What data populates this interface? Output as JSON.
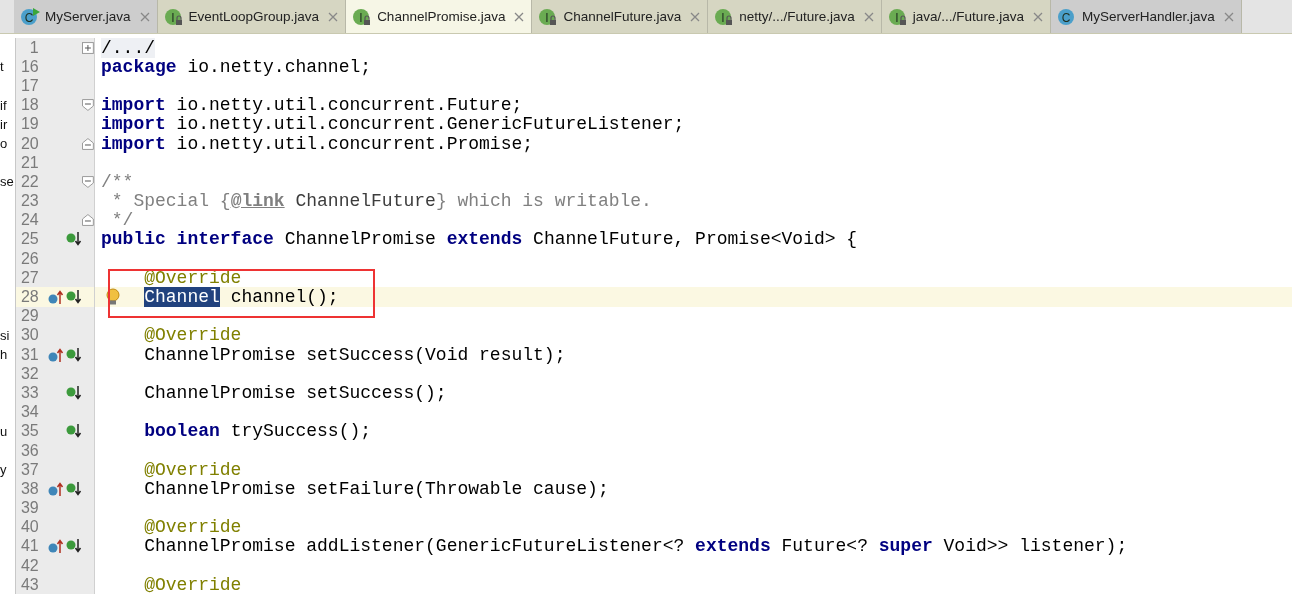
{
  "tabs": [
    {
      "label": "MyServer.java",
      "kind": "class-run",
      "icon_letter": "C",
      "selected": false
    },
    {
      "label": "EventLoopGroup.java",
      "kind": "interface",
      "icon_letter": "I",
      "selected": false
    },
    {
      "label": "ChannelPromise.java",
      "kind": "interface",
      "icon_letter": "I",
      "selected": true
    },
    {
      "label": "ChannelFuture.java",
      "kind": "interface",
      "icon_letter": "I",
      "selected": false
    },
    {
      "label": "netty/.../Future.java",
      "kind": "interface",
      "icon_letter": "I",
      "selected": false
    },
    {
      "label": "java/.../Future.java",
      "kind": "interface",
      "icon_letter": "I",
      "selected": false
    },
    {
      "label": "MyServerHandler.java",
      "kind": "class",
      "icon_letter": "C",
      "selected": false
    }
  ],
  "lines": [
    {
      "number": "1",
      "fold": {
        "kind": "collapsed"
      },
      "tokens": [
        {
          "kind": "folded",
          "text": "/.../"
        }
      ]
    },
    {
      "number": "16",
      "side": "t",
      "tokens": [
        {
          "kind": "keyword",
          "text": "package"
        },
        {
          "kind": "plain",
          "text": " io.netty.channel;"
        }
      ]
    },
    {
      "number": "17"
    },
    {
      "number": "18",
      "side": "if",
      "fold": {
        "kind": "start"
      },
      "tokens": [
        {
          "kind": "keyword",
          "text": "import"
        },
        {
          "kind": "plain",
          "text": " io.netty.util.concurrent.Future;"
        }
      ]
    },
    {
      "number": "19",
      "side": "ir",
      "tokens": [
        {
          "kind": "keyword",
          "text": "import"
        },
        {
          "kind": "plain",
          "text": " io.netty.util.concurrent.GenericFutureListener;"
        }
      ]
    },
    {
      "number": "20",
      "side": "o",
      "fold": {
        "kind": "end"
      },
      "tokens": [
        {
          "kind": "keyword",
          "text": "import"
        },
        {
          "kind": "plain",
          "text": " io.netty.util.concurrent.Promise;"
        }
      ]
    },
    {
      "number": "21"
    },
    {
      "number": "22",
      "side": "se",
      "fold": {
        "kind": "start"
      },
      "tokens": [
        {
          "kind": "comment",
          "text": "/**"
        }
      ]
    },
    {
      "number": "23",
      "tokens": [
        {
          "kind": "comment",
          "text": " * Special {"
        },
        {
          "kind": "doctag",
          "text": "@link"
        },
        {
          "kind": "docref",
          "text": " ChannelFuture"
        },
        {
          "kind": "comment",
          "text": "} which is writable."
        }
      ]
    },
    {
      "number": "24",
      "fold": {
        "kind": "end"
      },
      "tokens": [
        {
          "kind": "comment",
          "text": " */"
        }
      ]
    },
    {
      "number": "25",
      "markers": [
        {
          "kind": "implemented"
        }
      ],
      "tokens": [
        {
          "kind": "keyword",
          "text": "public interface"
        },
        {
          "kind": "plain",
          "text": " ChannelPromise "
        },
        {
          "kind": "keyword",
          "text": "extends"
        },
        {
          "kind": "plain",
          "text": " ChannelFuture, Promise<Void> {"
        }
      ],
      "children": [
        {
          "number": "26"
        },
        {
          "number": "27",
          "boxed": true,
          "tokens": [
            {
              "kind": "annotation",
              "text": "@Override"
            }
          ]
        },
        {
          "number": "28",
          "boxed": true,
          "current": true,
          "bulb": true,
          "markers": [
            {
              "kind": "overrides"
            },
            {
              "kind": "implemented"
            }
          ],
          "tokens": [
            {
              "kind": "plain",
              "text": "Channel",
              "selected": true
            },
            {
              "kind": "plain",
              "text": " channel();"
            }
          ]
        },
        {
          "number": "29"
        },
        {
          "number": "30",
          "side": "si",
          "tokens": [
            {
              "kind": "annotation",
              "text": "@Override"
            }
          ]
        },
        {
          "number": "31",
          "side": "h",
          "markers": [
            {
              "kind": "overrides"
            },
            {
              "kind": "implemented"
            }
          ],
          "tokens": [
            {
              "kind": "plain",
              "text": "ChannelPromise setSuccess(Void result);"
            }
          ]
        },
        {
          "number": "32"
        },
        {
          "number": "33",
          "markers": [
            {
              "kind": "implemented"
            }
          ],
          "tokens": [
            {
              "kind": "plain",
              "text": "ChannelPromise setSuccess();"
            }
          ]
        },
        {
          "number": "34"
        },
        {
          "number": "35",
          "side": "u",
          "markers": [
            {
              "kind": "implemented"
            }
          ],
          "tokens": [
            {
              "kind": "keyword",
              "text": "boolean"
            },
            {
              "kind": "plain",
              "text": " trySuccess();"
            }
          ]
        },
        {
          "number": "36"
        },
        {
          "number": "37",
          "side": "y",
          "tokens": [
            {
              "kind": "annotation",
              "text": "@Override"
            }
          ]
        },
        {
          "number": "38",
          "markers": [
            {
              "kind": "overrides"
            },
            {
              "kind": "implemented"
            }
          ],
          "tokens": [
            {
              "kind": "plain",
              "text": "ChannelPromise setFailure(Throwable cause);"
            }
          ]
        },
        {
          "number": "39"
        },
        {
          "number": "40",
          "tokens": [
            {
              "kind": "annotation",
              "text": "@Override"
            }
          ]
        },
        {
          "number": "41",
          "markers": [
            {
              "kind": "overrides"
            },
            {
              "kind": "implemented"
            }
          ],
          "tokens": [
            {
              "kind": "plain",
              "text": "ChannelPromise addListener(GenericFutureListener<? "
            },
            {
              "kind": "keyword",
              "text": "extends"
            },
            {
              "kind": "plain",
              "text": " Future<? "
            },
            {
              "kind": "keyword",
              "text": "super"
            },
            {
              "kind": "plain",
              "text": " Void>> listener);"
            }
          ]
        },
        {
          "number": "42"
        },
        {
          "number": "43",
          "tokens": [
            {
              "kind": "annotation",
              "text": "@Override"
            }
          ]
        }
      ]
    }
  ]
}
